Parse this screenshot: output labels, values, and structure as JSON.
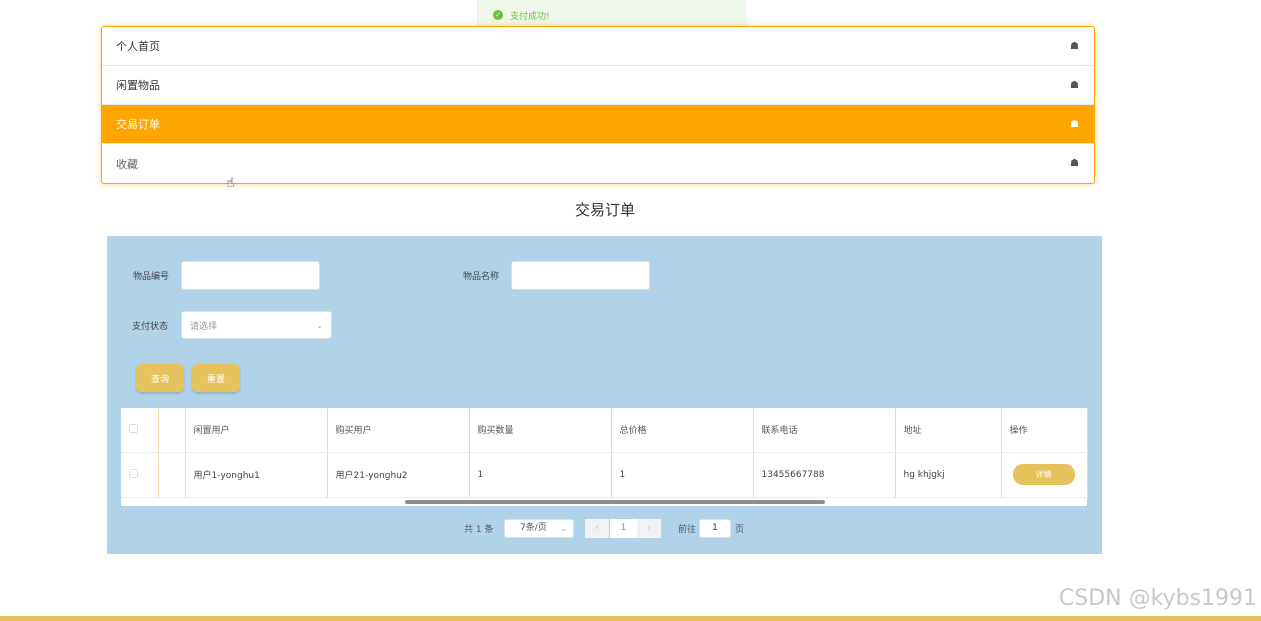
{
  "toast": {
    "message": "支付成功!"
  },
  "menu": {
    "items": [
      {
        "label": "个人首页",
        "icon": "home-icon",
        "active": false
      },
      {
        "label": "闲置物品",
        "icon": "home-icon",
        "active": false
      },
      {
        "label": "交易订单",
        "icon": "home-icon",
        "active": true
      },
      {
        "label": "收藏",
        "icon": "home-icon",
        "active": false
      }
    ]
  },
  "page_title": "交易订单",
  "search": {
    "item_no_label": "物品编号",
    "item_no_value": "",
    "item_name_label": "物品名称",
    "item_name_value": "",
    "pay_status_label": "支付状态",
    "pay_status_placeholder": "请选择",
    "query_button": "查询",
    "reset_button": "重置"
  },
  "table": {
    "columns": [
      "",
      "",
      "闲置用户",
      "购买用户",
      "购买数量",
      "总价格",
      "联系电话",
      "地址",
      "操作"
    ],
    "rows": [
      {
        "idle_user": "用户1-yonghu1",
        "buyer": "用户21-yonghu2",
        "quantity": "1",
        "total_price": "1",
        "phone": "13455667788",
        "address": "hg khjgkj",
        "action": "详情"
      }
    ]
  },
  "pagination": {
    "total": "共 1 条",
    "page_size": "7条/页",
    "prev": "‹",
    "current": "1",
    "next": "›",
    "goto_label": "前往",
    "goto_value": "1",
    "page_suffix": "页"
  },
  "watermark": "CSDN @kybs1991",
  "colors": {
    "accent": "#ffa500",
    "panel": "#b0d3ea",
    "button": "#e6c35c",
    "success": "#67c23a"
  }
}
